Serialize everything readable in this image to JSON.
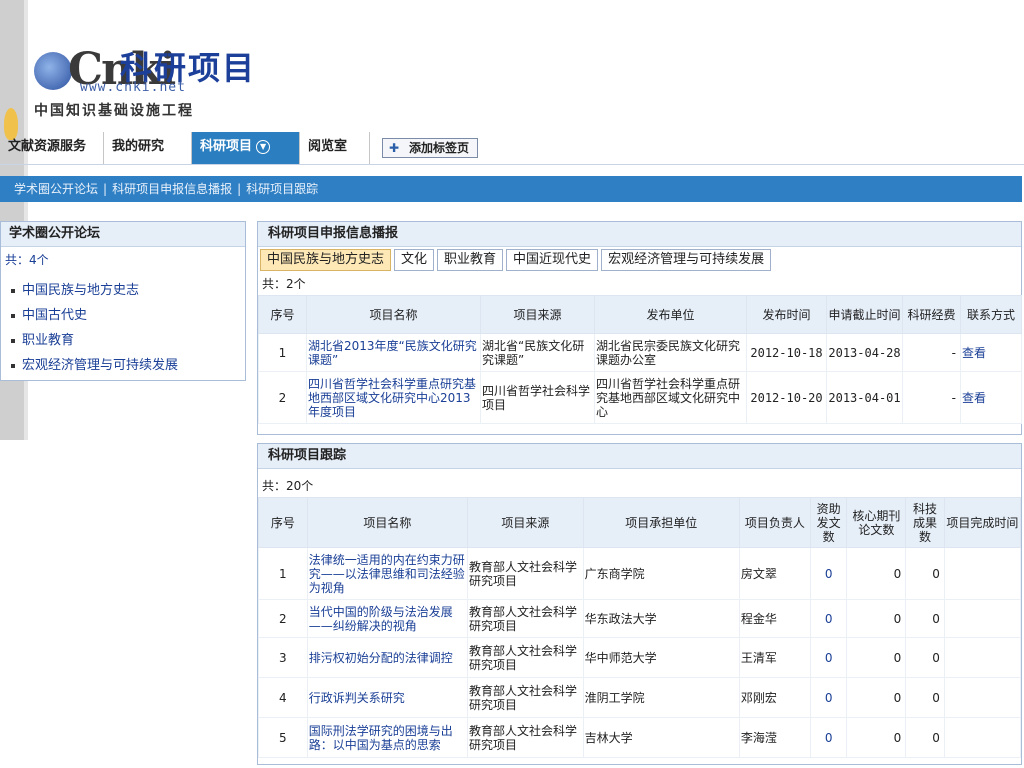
{
  "logo": {
    "wordmark": "Cnki",
    "overlay_title": "科研项目",
    "url": "www.cnki.net",
    "tagline": "中国知识基础设施工程"
  },
  "tabs": {
    "items": [
      "文献资源服务",
      "我的研究",
      "科研项目",
      "阅览室"
    ],
    "active": "科研项目",
    "add_label": "添加标签页"
  },
  "subnav": {
    "items": [
      "学术圈公开论坛",
      "科研项目申报信息播报",
      "科研项目跟踪"
    ],
    "separator": "|"
  },
  "forum": {
    "title": "学术圈公开论坛",
    "count": "共：4个",
    "items": [
      "中国民族与地方史志",
      "中国古代史",
      "职业教育",
      "宏观经济管理与可持续发展"
    ]
  },
  "broadcast": {
    "title": "科研项目申报信息播报",
    "tabs": [
      "中国民族与地方史志",
      "文化",
      "职业教育",
      "中国近现代史",
      "宏观经济管理与可持续发展"
    ],
    "active_tab": "中国民族与地方史志",
    "count": "共：2个",
    "headers": [
      "序号",
      "项目名称",
      "项目来源",
      "发布单位",
      "发布时间",
      "申请截止时间",
      "科研经费",
      "联系方式"
    ],
    "rows": [
      {
        "no": "1",
        "name": "湖北省2013年度“民族文化研究课题”",
        "source": "湖北省“民族文化研究课题”",
        "publisher": "湖北省民宗委民族文化研究课题办公室",
        "date": "2012-10-18",
        "deadline": "2013-04-28",
        "funding": "-",
        "contact": "查看"
      },
      {
        "no": "2",
        "name": "四川省哲学社会科学重点研究基地西部区域文化研究中心2013年度项目",
        "source": "四川省哲学社会科学项目",
        "publisher": "四川省哲学社会科学重点研究基地西部区域文化研究中心",
        "date": "2012-10-20",
        "deadline": "2013-04-01",
        "funding": "-",
        "contact": "查看"
      }
    ]
  },
  "tracking": {
    "title": "科研项目跟踪",
    "count": "共：20个",
    "headers": [
      "序号",
      "项目名称",
      "项目来源",
      "项目承担单位",
      "项目负责人",
      "资助发文数",
      "核心期刊论文数",
      "科技成果数",
      "项目完成时间"
    ],
    "rows": [
      {
        "no": "1",
        "name": "法律统一适用的内在约束力研究——以法律思维和司法经验为视角",
        "source": "教育部人文社会科学研究项目",
        "unit": "广东商学院",
        "leader": "房文翠",
        "papers": "0",
        "core": "0",
        "achievements": "0",
        "finish": ""
      },
      {
        "no": "2",
        "name": "当代中国的阶级与法治发展——纠纷解决的视角",
        "source": "教育部人文社会科学研究项目",
        "unit": "华东政法大学",
        "leader": "程金华",
        "papers": "0",
        "core": "0",
        "achievements": "0",
        "finish": ""
      },
      {
        "no": "3",
        "name": "排污权初始分配的法律调控",
        "source": "教育部人文社会科学研究项目",
        "unit": "华中师范大学",
        "leader": "王清军",
        "papers": "0",
        "core": "0",
        "achievements": "0",
        "finish": ""
      },
      {
        "no": "4",
        "name": "行政诉判关系研究",
        "source": "教育部人文社会科学研究项目",
        "unit": "淮阴工学院",
        "leader": "邓刚宏",
        "papers": "0",
        "core": "0",
        "achievements": "0",
        "finish": ""
      },
      {
        "no": "5",
        "name": "国际刑法学研究的困境与出路：以中国为基点的思索",
        "source": "教育部人文社会科学研究项目",
        "unit": "吉林大学",
        "leader": "李海滢",
        "papers": "0",
        "core": "0",
        "achievements": "0",
        "finish": ""
      }
    ]
  }
}
